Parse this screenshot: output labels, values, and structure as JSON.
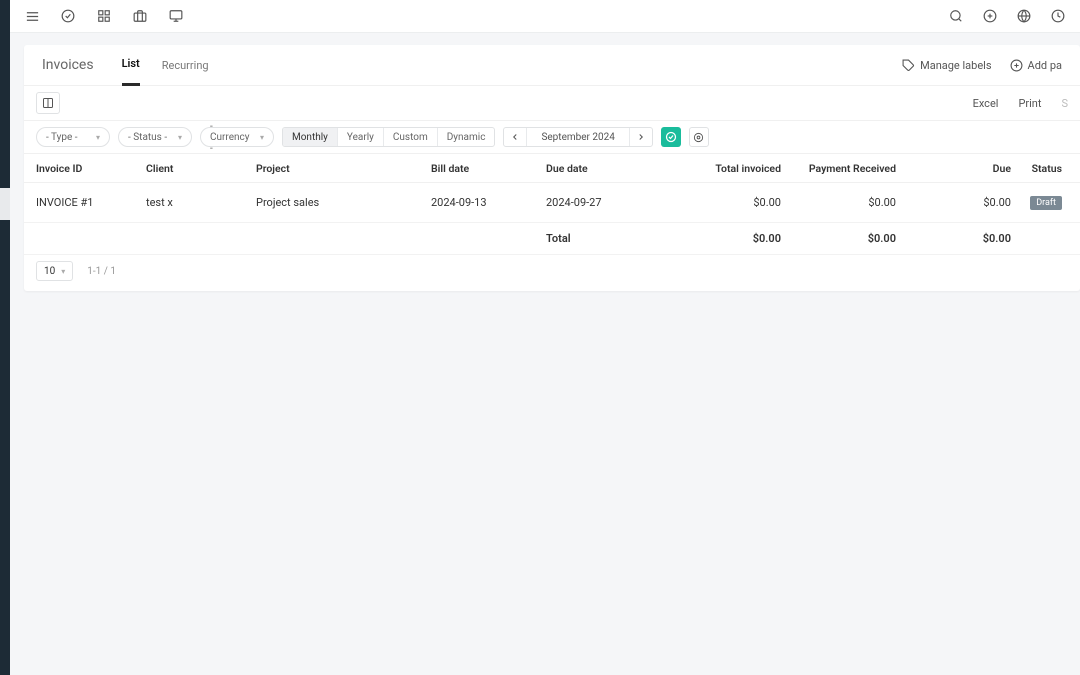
{
  "page": {
    "title": "Invoices",
    "tabs": {
      "list": "List",
      "recurring": "Recurring"
    },
    "active_tab": "list"
  },
  "header_actions": {
    "manage_labels": "Manage labels",
    "add_payment": "Add pa"
  },
  "export": {
    "excel": "Excel",
    "print": "Print"
  },
  "filters": {
    "type": "- Type -",
    "status": "- Status -",
    "currency": "- Currency -"
  },
  "freq": {
    "monthly": "Monthly",
    "yearly": "Yearly",
    "custom": "Custom",
    "dynamic": "Dynamic",
    "active": "monthly"
  },
  "date_nav": {
    "label": "September 2024"
  },
  "table": {
    "columns": {
      "invoice_id": "Invoice ID",
      "client": "Client",
      "project": "Project",
      "bill_date": "Bill date",
      "due_date": "Due date",
      "total_invoiced": "Total invoiced",
      "payment_received": "Payment Received",
      "due": "Due",
      "status": "Status"
    },
    "rows": [
      {
        "invoice_id": "INVOICE #1",
        "client": "test x",
        "project": "Project sales",
        "bill_date": "2024-09-13",
        "due_date": "2024-09-27",
        "total_invoiced": "$0.00",
        "payment_received": "$0.00",
        "due": "$0.00",
        "status": "Draft"
      }
    ],
    "total": {
      "label": "Total",
      "total_invoiced": "$0.00",
      "payment_received": "$0.00",
      "due": "$0.00"
    }
  },
  "pager": {
    "page_size": "10",
    "range": "1-1 / 1"
  }
}
